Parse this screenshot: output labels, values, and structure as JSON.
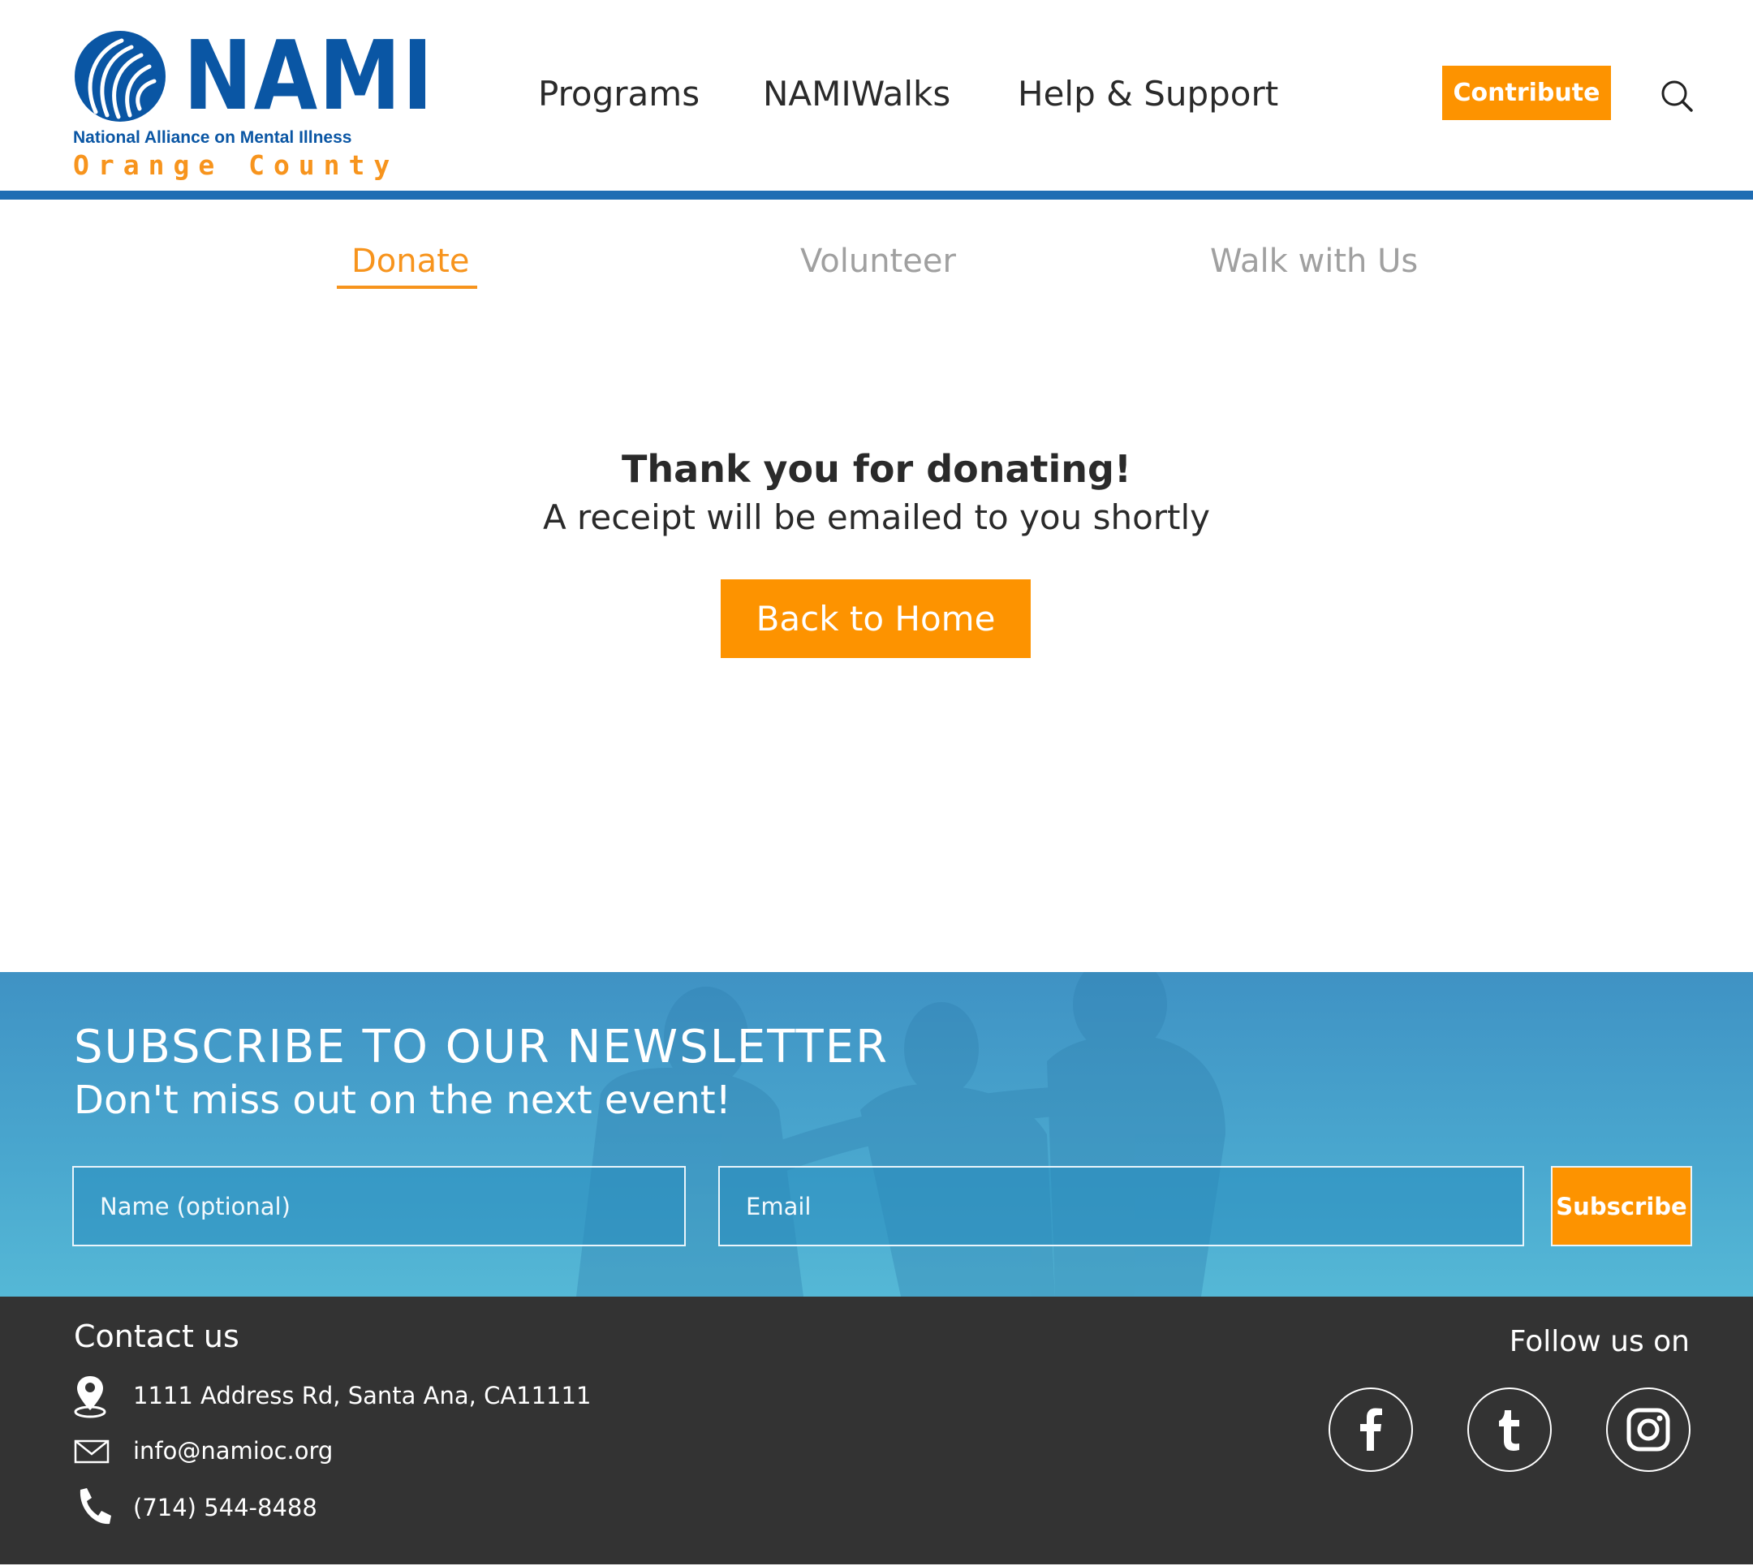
{
  "brand": {
    "wordmark": "NAMI",
    "subtitle": "National Alliance on Mental Illness",
    "chapter": "Orange County",
    "primary_color": "#0a56a4",
    "accent_color": "#fd9300"
  },
  "nav": {
    "items": [
      {
        "label": "Programs"
      },
      {
        "label": "NAMIWalks"
      },
      {
        "label": "Help & Support"
      }
    ],
    "contribute_label": "Contribute",
    "search_icon": "search-icon"
  },
  "tabs": [
    {
      "label": "Donate",
      "active": true
    },
    {
      "label": "Volunteer",
      "active": false
    },
    {
      "label": "Walk with Us",
      "active": false
    }
  ],
  "confirmation": {
    "title": "Thank you for donating!",
    "message": "A receipt will be emailed to you shortly",
    "button_label": "Back to Home"
  },
  "newsletter": {
    "title": "SUBSCRIBE TO OUR NEWSLETTER",
    "subtitle": "Don't miss out on the next event!",
    "name_placeholder": "Name (optional)",
    "email_placeholder": "Email",
    "subscribe_label": "Subscribe"
  },
  "footer": {
    "contact_title": "Contact us",
    "address": "1111 Address Rd, Santa Ana, CA11111",
    "email": "info@namioc.org",
    "phone": "(714) 544-8488",
    "follow_label": "Follow us on",
    "social": [
      {
        "icon": "facebook-icon"
      },
      {
        "icon": "tumblr-icon"
      },
      {
        "icon": "instagram-icon"
      }
    ]
  }
}
